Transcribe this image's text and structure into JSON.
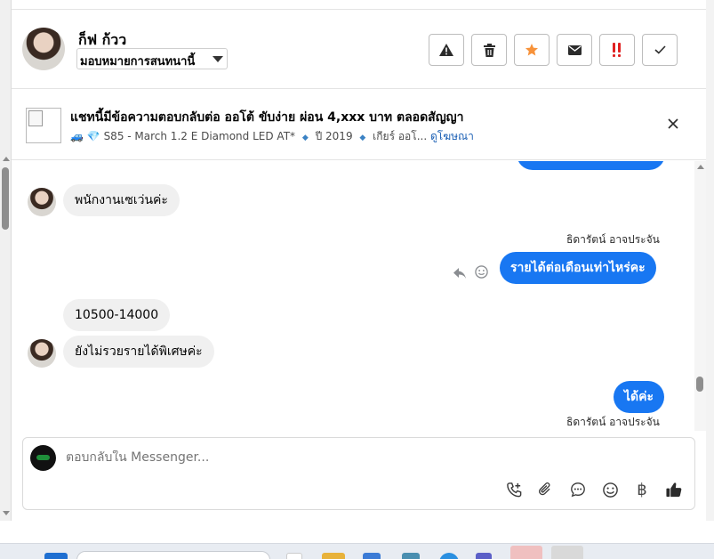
{
  "header": {
    "contact_name": "ก็ฟ ก้วว",
    "assign_label": "มอบหมายการสนทนานี้",
    "tools": [
      "warning-icon",
      "trash-icon",
      "star-icon",
      "envelope-icon",
      "urgent-icon",
      "check-icon"
    ],
    "colors": {
      "star": "#f7923a",
      "urgent": "#e02020"
    }
  },
  "ad": {
    "title": "แชทนี้มีข้อความตอบกลับต่อ ออโต้ ขับง่าย ผ่อน 4,xxx บาท ตลอดสัญญา",
    "model": "S85 - March 1.2 E Diamond LED AT*",
    "year": "ปี 2019",
    "gear": "เกียร์ ออโ...",
    "link": "ดูโฆษณา"
  },
  "messages": {
    "m1": "พนักงานเซเว่นค่ะ",
    "sender1": "ธิดารัตน์ อาจประจัน",
    "m2": "รายได้ต่อเดือนเท่าไหร่คะ",
    "m3": "10500-14000",
    "m4": "ยังไม่รวยรายได้พิเศษค่ะ",
    "m5": "ได้ค่ะ",
    "sender2": "ธิดารัตน์ อาจประจัน"
  },
  "composer": {
    "placeholder": "ตอบกลับใน Messenger...",
    "baht": "฿"
  },
  "theme": {
    "accent": "#1877f2",
    "incoming": "#f0f0f0"
  }
}
